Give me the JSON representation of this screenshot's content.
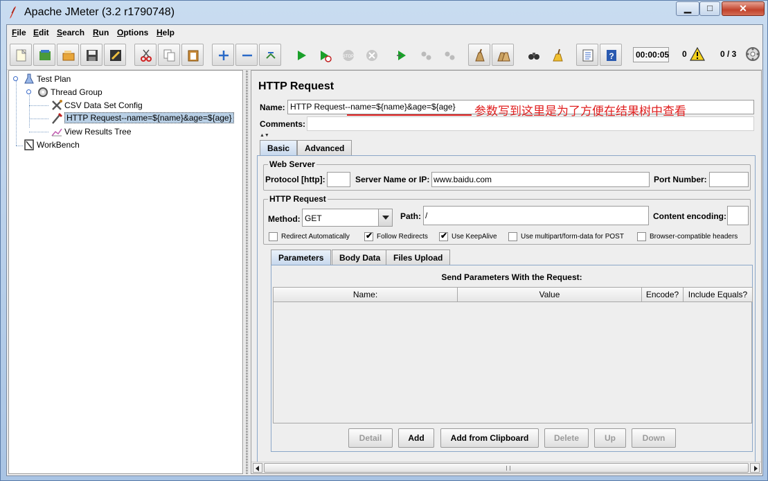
{
  "window": {
    "title": "Apache JMeter (3.2 r1790748)"
  },
  "menu": [
    "File",
    "Edit",
    "Search",
    "Run",
    "Options",
    "Help"
  ],
  "menu_mnemonic": [
    "F",
    "E",
    "S",
    "R",
    "O",
    "H"
  ],
  "toolbar": {
    "icons": [
      "new-icon",
      "templates-icon",
      "open-icon",
      "save-icon",
      "save-screenshot-icon",
      "cut-icon",
      "copy-icon",
      "paste-icon",
      "expand-icon",
      "collapse-icon",
      "toggle-icon",
      "start-icon",
      "start-no-pause-icon",
      "stop-icon",
      "shutdown-icon",
      "remote-start-icon",
      "remote-stop-icon",
      "remote-shutdown-icon",
      "clear-icon",
      "clear-all-icon",
      "search-icon",
      "reset-search-icon",
      "function-helper-icon",
      "help-icon"
    ],
    "timer": "00:00:05",
    "error_count": "0",
    "threads": "0 / 3"
  },
  "tree": {
    "items": [
      {
        "label": "Test Plan",
        "icon": "test-plan-icon"
      },
      {
        "label": "Thread Group",
        "icon": "thread-group-icon"
      },
      {
        "label": "CSV Data Set Config",
        "icon": "config-icon"
      },
      {
        "label": "HTTP Request--name=${name}&age=${age}",
        "icon": "sampler-icon"
      },
      {
        "label": "View Results Tree",
        "icon": "listener-icon"
      },
      {
        "label": "WorkBench",
        "icon": "workbench-icon"
      }
    ]
  },
  "panel": {
    "title": "HTTP Request",
    "name_label": "Name:",
    "name_value": "HTTP Request--name=${name}&age=${age}",
    "annotation": "参数写到这里是为了方便在结果树中查看",
    "comments_label": "Comments:",
    "tabs": [
      "Basic",
      "Advanced"
    ],
    "web_server": {
      "title": "Web Server",
      "protocol_label": "Protocol [http]:",
      "protocol_value": "",
      "server_label": "Server Name or IP:",
      "server_value": "www.baidu.com",
      "port_label": "Port Number:",
      "port_value": ""
    },
    "http_request": {
      "title": "HTTP Request",
      "method_label": "Method:",
      "method_value": "GET",
      "path_label": "Path:",
      "path_value": "/",
      "encoding_label": "Content encoding:",
      "encoding_value": ""
    },
    "checkboxes": [
      {
        "label": "Redirect Automatically",
        "checked": false
      },
      {
        "label": "Follow Redirects",
        "checked": true
      },
      {
        "label": "Use KeepAlive",
        "checked": true
      },
      {
        "label": "Use multipart/form-data for POST",
        "checked": false
      },
      {
        "label": "Browser-compatible headers",
        "checked": false
      }
    ],
    "subtabs": [
      "Parameters",
      "Body Data",
      "Files Upload"
    ],
    "params_title": "Send Parameters With the Request:",
    "columns": [
      "Name:",
      "Value",
      "Encode?",
      "Include Equals?"
    ],
    "buttons": [
      {
        "label": "Detail",
        "enabled": false
      },
      {
        "label": "Add",
        "enabled": true
      },
      {
        "label": "Add from Clipboard",
        "enabled": true
      },
      {
        "label": "Delete",
        "enabled": false
      },
      {
        "label": "Up",
        "enabled": false
      },
      {
        "label": "Down",
        "enabled": false
      }
    ]
  },
  "colors": {
    "annotation": "#e02020",
    "selection": "#b8cfe5",
    "accent_tab": "#c6d7ec"
  }
}
